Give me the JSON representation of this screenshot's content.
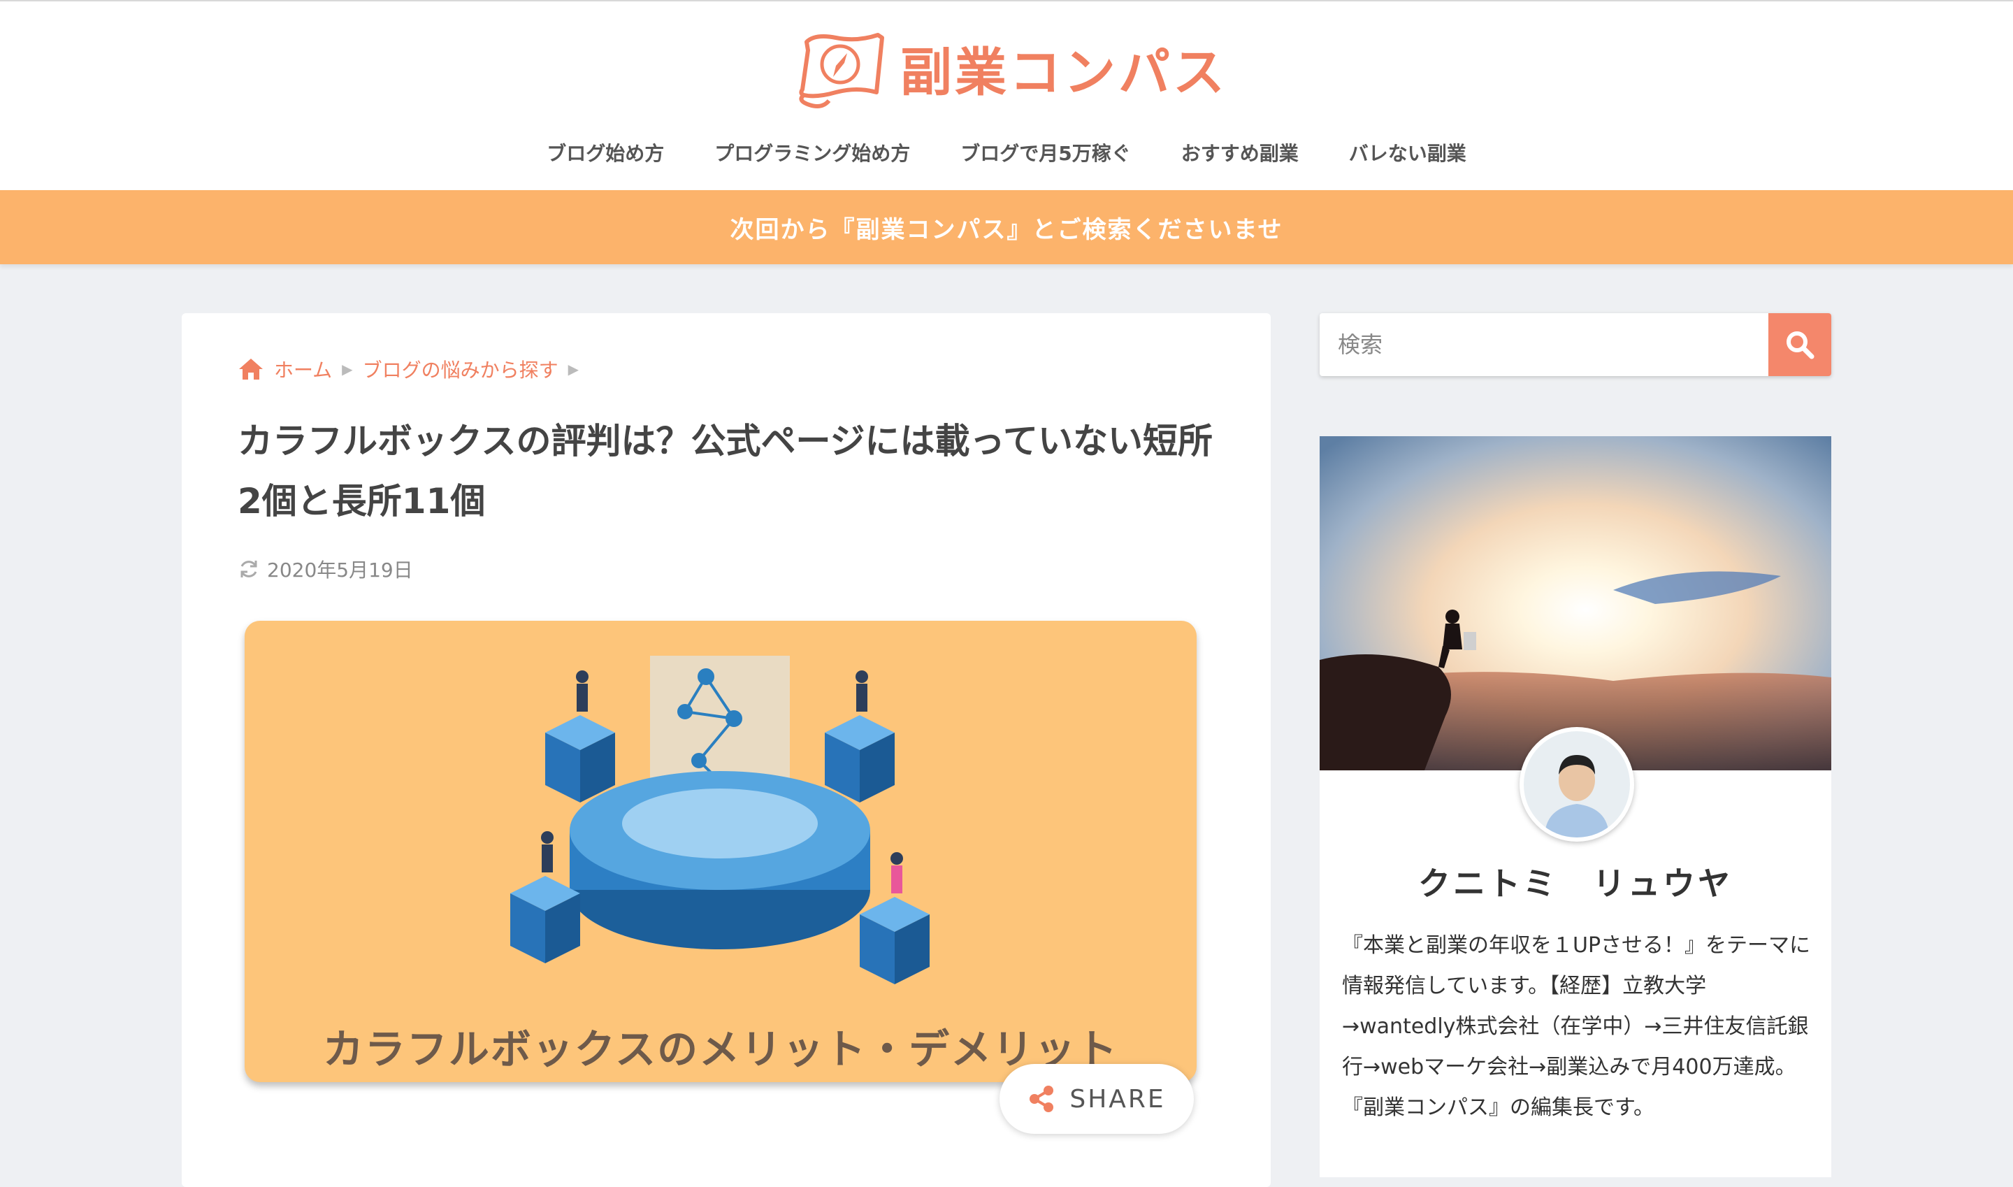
{
  "site": {
    "logo_text": "副業コンパス",
    "nav": [
      "ブログ始め方",
      "プログラミング始め方",
      "ブログで月5万稼ぐ",
      "おすすめ副業",
      "バレない副業"
    ],
    "notice": "次回から『副業コンパス』とご検索くださいませ",
    "accent_color": "#f08060",
    "notice_color": "#fcb36b"
  },
  "article": {
    "breadcrumb": [
      "ホーム",
      "ブログの悩みから探す"
    ],
    "title": "カラフルボックスの評判は？公式ページには載っていない短所2個と長所11個",
    "date": "2020年5月19日",
    "eyecatch_caption": "カラフルボックスのメリット・デメリット",
    "share_label": "SHARE"
  },
  "sidebar": {
    "search_placeholder": "検索",
    "profile_name": "クニトミ　リュウヤ",
    "profile_bio": "『本業と副業の年収を１UPさせる！』をテーマに情報発信しています。【経歴】立教大学→wantedly株式会社（在学中）→三井住友信託銀行→webマーケ会社→副業込みで月400万達成。『副業コンパス』の編集長です。"
  }
}
